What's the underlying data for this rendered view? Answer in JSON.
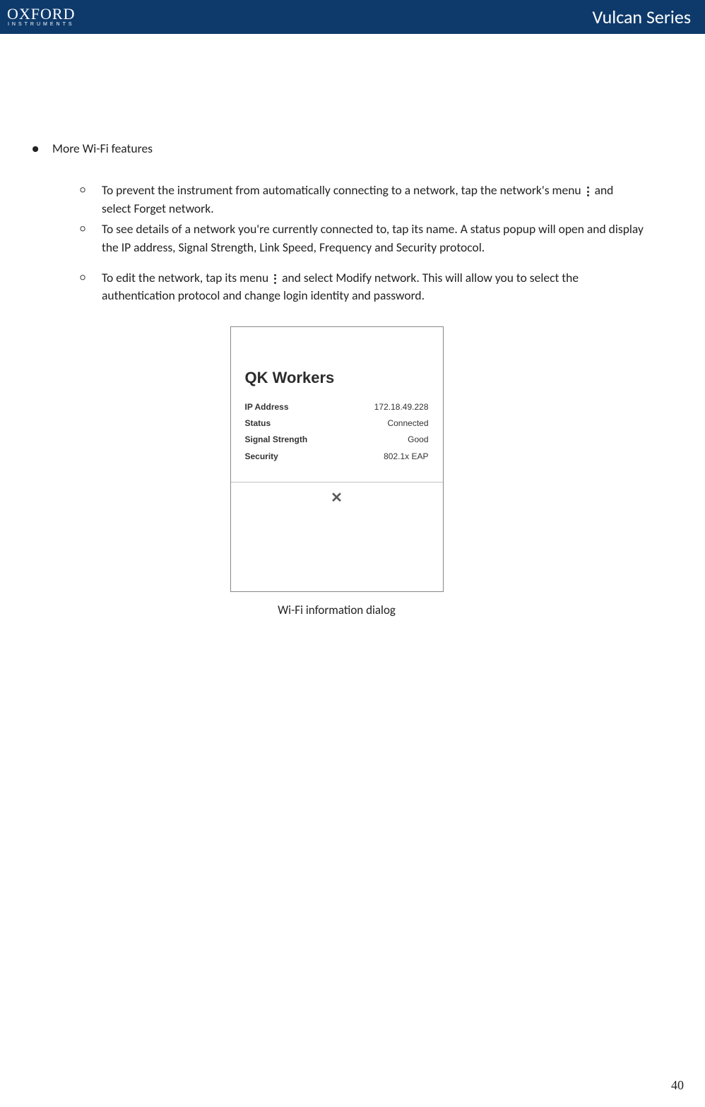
{
  "header": {
    "logo_top": "OXFORD",
    "logo_bottom": "INSTRUMENTS",
    "title": "Vulcan Series"
  },
  "content": {
    "bullet_heading": "More Wi-Fi features",
    "sub_items": [
      {
        "pre": "To prevent the instrument from automatically connecting to a network, tap the network's menu",
        "post": "and select Forget network."
      },
      {
        "full": "To see details of a network you're currently connected to, tap its name. A status popup will open and display the IP address, Signal Strength, Link Speed, Frequency and Security protocol."
      },
      {
        "pre": "To edit the network, tap its menu",
        "post": "and select Modify network. This will allow you to select the authentication protocol and change login identity and password."
      }
    ],
    "popup": {
      "title": "QK Workers",
      "rows": [
        {
          "label": "IP Address",
          "value": "172.18.49.228"
        },
        {
          "label": "Status",
          "value": "Connected"
        },
        {
          "label": "Signal Strength",
          "value": "Good"
        },
        {
          "label": "Security",
          "value": "802.1x EAP"
        }
      ]
    },
    "caption": "Wi-Fi information dialog"
  },
  "page_number": "40"
}
